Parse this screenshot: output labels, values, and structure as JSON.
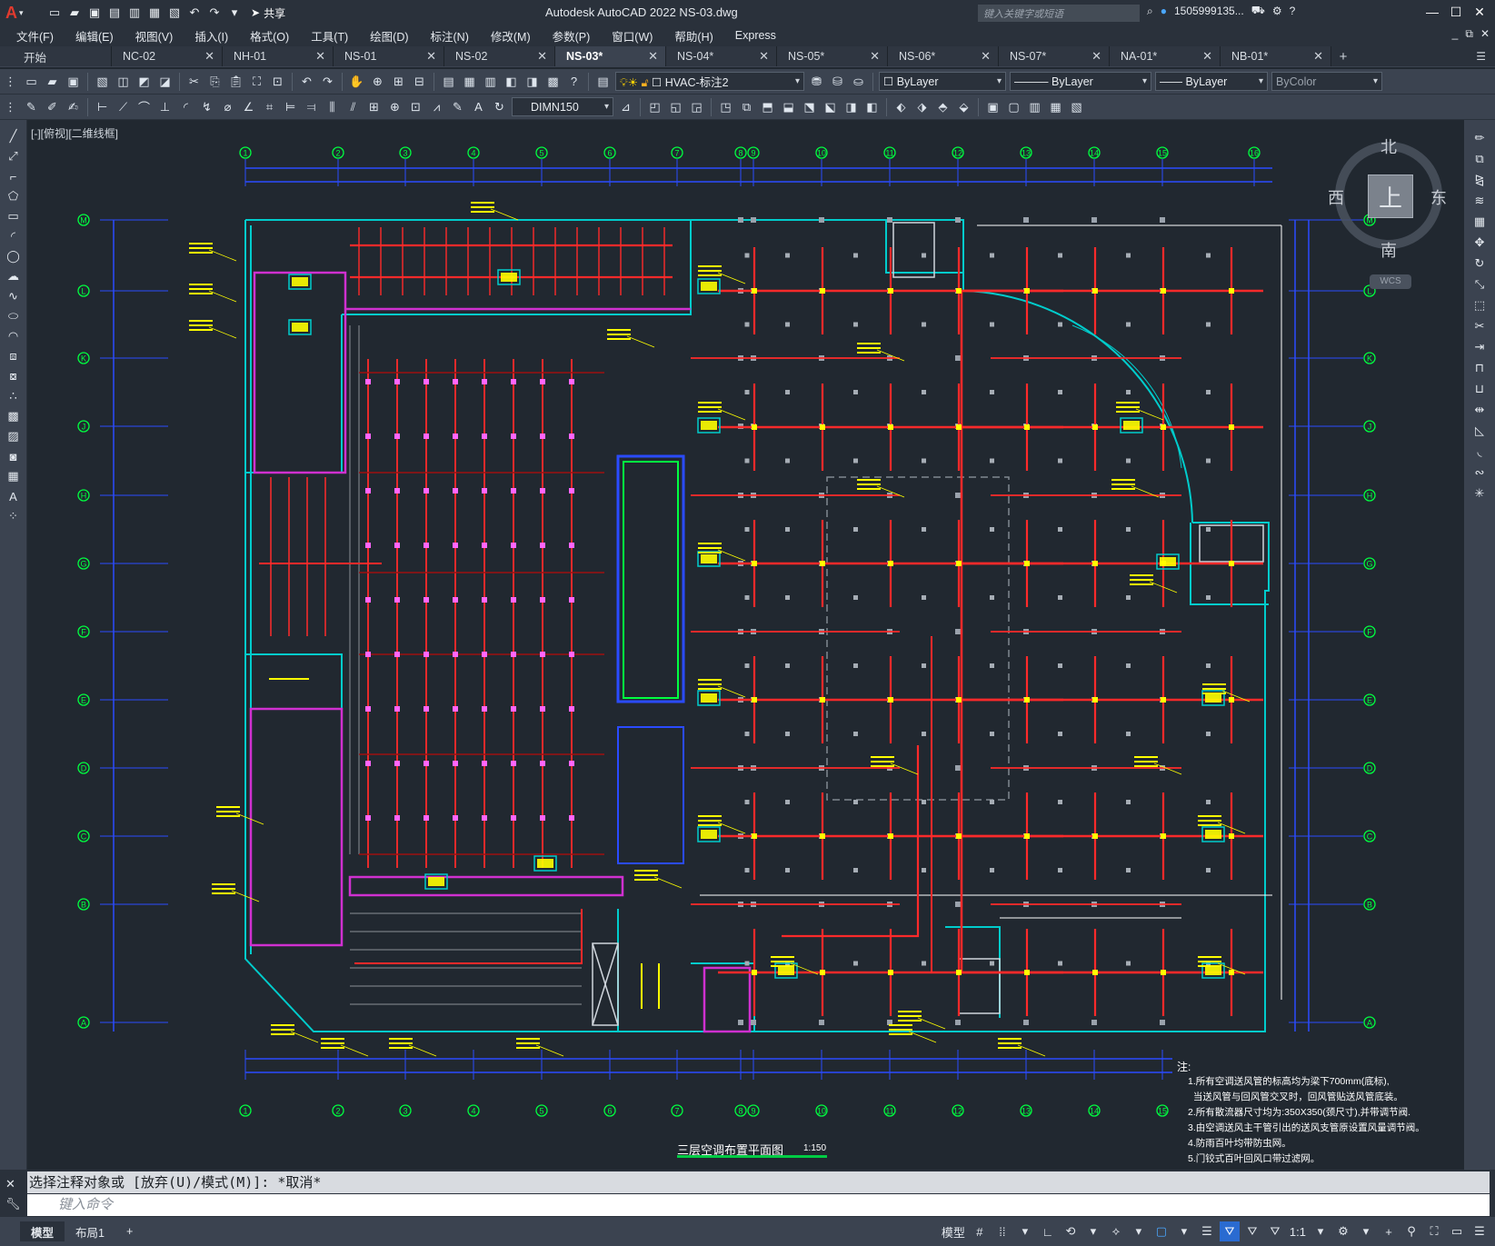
{
  "app": {
    "window_title": "Autodesk AutoCAD 2022    NS-03.dwg",
    "search_placeholder": "键入关键字或短语",
    "user": "1505999135...",
    "share": "共享"
  },
  "menu": [
    "文件(F)",
    "编辑(E)",
    "视图(V)",
    "插入(I)",
    "格式(O)",
    "工具(T)",
    "绘图(D)",
    "标注(N)",
    "修改(M)",
    "参数(P)",
    "窗口(W)",
    "帮助(H)",
    "Express"
  ],
  "tabs": [
    {
      "label": "开始",
      "active": false
    },
    {
      "label": "NC-02",
      "active": false
    },
    {
      "label": "NH-01",
      "active": false
    },
    {
      "label": "NS-01",
      "active": false
    },
    {
      "label": "NS-02",
      "active": false
    },
    {
      "label": "NS-03*",
      "active": true
    },
    {
      "label": "NS-04*",
      "active": false
    },
    {
      "label": "NS-05*",
      "active": false
    },
    {
      "label": "NS-06*",
      "active": false
    },
    {
      "label": "NS-07*",
      "active": false
    },
    {
      "label": "NA-01*",
      "active": false
    },
    {
      "label": "NB-01*",
      "active": false
    }
  ],
  "toolbar": {
    "layer": "HVAC-标注2",
    "color": "ByLayer",
    "linetype": "ByLayer",
    "lineweight": "ByLayer",
    "plotstyle": "ByColor",
    "dimstyle": "DIMN150"
  },
  "viewport_label": "[-][俯视][二维线框]",
  "viewcube": {
    "north": "北",
    "south": "南",
    "east": "东",
    "west": "西",
    "top": "上",
    "wcs": "WCS"
  },
  "drawing": {
    "title": "三层空调布置平面图",
    "scale": "1:150",
    "col_axes": [
      "1",
      "2",
      "3",
      "4",
      "5",
      "6",
      "7",
      "8",
      "9",
      "10",
      "11",
      "12",
      "13",
      "14",
      "15",
      "16"
    ],
    "row_axes": [
      "M",
      "L",
      "K",
      "J",
      "H",
      "G",
      "F",
      "E",
      "D",
      "C",
      "B",
      "A"
    ],
    "notes_head": "注:",
    "notes": [
      "1.所有空调送风管的标高均为梁下700mm(底标),",
      "  当送风管与回风管交叉时，回风管贴送风管底装。",
      "2.所有散流器尺寸均为:350X350(颈尺寸),并带调节阀.",
      "3.由空调送风主干管引出的送风支管原设置风量调节阀。",
      "4.防雨百叶均带防虫网。",
      "5.门铰式百叶回风口带过滤网。"
    ]
  },
  "command": {
    "history": "选择注释对象或 [放弃(U)/模式(M)]: *取消*",
    "placeholder": "键入命令"
  },
  "layouts": [
    "模型",
    "布局1"
  ],
  "status": {
    "model": "模型",
    "scale": "1:1"
  },
  "colors": {
    "bg": "#212830",
    "duct": "#ff2a2a",
    "wall": "#00cccc",
    "grid": "#3a5cff",
    "anno": "#ffff00",
    "accent": "#4aa7ff"
  }
}
